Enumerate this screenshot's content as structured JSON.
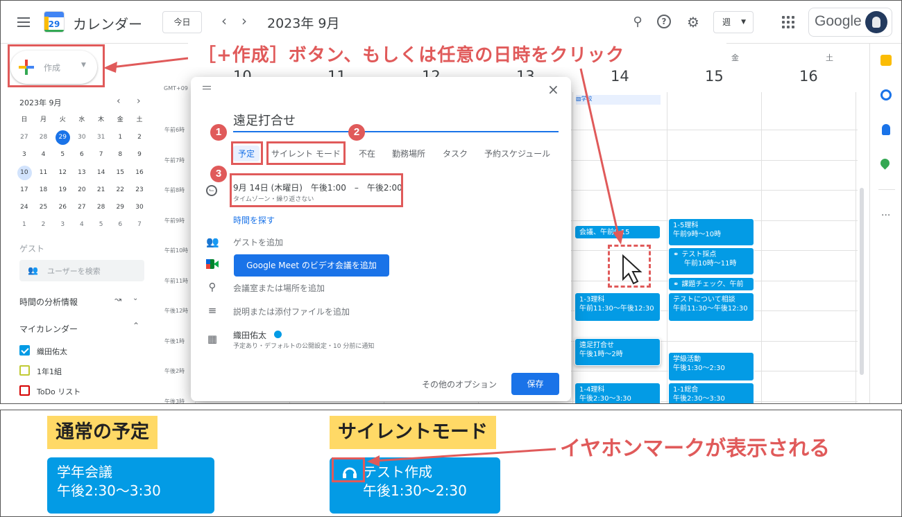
{
  "header": {
    "app_title": "カレンダー",
    "logo_day": "29",
    "today_label": "今日",
    "month_title": "2023年 9月",
    "view_label": "週",
    "google_label": "Google"
  },
  "sidebar": {
    "create_label": "作成",
    "mini_month": "2023年 9月",
    "weekdays": [
      "日",
      "月",
      "火",
      "水",
      "木",
      "金",
      "土"
    ],
    "weeks": [
      [
        "27",
        "28",
        "29",
        "30",
        "31",
        "1",
        "2"
      ],
      [
        "3",
        "4",
        "5",
        "6",
        "7",
        "8",
        "9"
      ],
      [
        "10",
        "11",
        "12",
        "13",
        "14",
        "15",
        "16"
      ],
      [
        "17",
        "18",
        "19",
        "20",
        "21",
        "22",
        "23"
      ],
      [
        "24",
        "25",
        "26",
        "27",
        "28",
        "29",
        "30"
      ],
      [
        "1",
        "2",
        "3",
        "4",
        "5",
        "6",
        "7"
      ]
    ],
    "guest_heading": "ゲスト",
    "guest_search_placeholder": "ユーザーを検索",
    "analytics_heading": "時間の分析情報",
    "my_calendars_heading": "マイカレンダー",
    "calendars": [
      {
        "name": "織田佑太",
        "color": "#039be5",
        "checked": true
      },
      {
        "name": "1年1組",
        "color": "#c0ca33",
        "checked": false
      },
      {
        "name": "ToDo リスト",
        "color": "#d50000",
        "checked": false
      }
    ]
  },
  "calendar": {
    "timezone": "GMT+09",
    "columns": [
      {
        "dow": "",
        "date": "10"
      },
      {
        "dow": "",
        "date": "11"
      },
      {
        "dow": "",
        "date": "12"
      },
      {
        "dow": "",
        "date": "13"
      },
      {
        "dow": "",
        "date": "14"
      },
      {
        "dow": "金",
        "date": "15"
      },
      {
        "dow": "土",
        "date": "16"
      }
    ],
    "time_labels": [
      "午前6時",
      "午前7時",
      "午前8時",
      "午前9時",
      "午前10時",
      "午前11時",
      "午後12時",
      "午後1時",
      "午後2時",
      "午後3時"
    ],
    "allday_event": "学校",
    "events": [
      {
        "title": "会議、午前9:15",
        "time": ""
      },
      {
        "title": "1-3理科",
        "time": "午前11:30～午後12:30"
      },
      {
        "title": "遠足打合せ",
        "time": "午後1時～2時"
      },
      {
        "title": "1-4理科",
        "time": "午後2:30～3:30"
      },
      {
        "title": "1-5理科",
        "time": "午前9時～10時"
      },
      {
        "title": "テスト採点",
        "time": "午前10時～11時",
        "silent": true
      },
      {
        "title": "課題チェック、午前",
        "time": "",
        "silent": true
      },
      {
        "title": "テストについて相談",
        "time": "午前11:30～午後12:30"
      },
      {
        "title": "学級活動",
        "time": "午後1:30～2:30"
      },
      {
        "title": "1-1総合",
        "time": "午後2:30～3:30"
      }
    ],
    "accent": "#039be5"
  },
  "dialog": {
    "title_value": "遠足打合せ",
    "tabs": [
      "予定",
      "サイレント モード",
      "不在",
      "勤務場所",
      "タスク",
      "予約スケジュール"
    ],
    "datetime": "9月 14日 (木曜日)　午後1:00　–　午後2:00",
    "datetime_sub": "タイムゾーン・繰り返さない",
    "find_time": "時間を探す",
    "add_guests": "ゲストを追加",
    "meet_button": "Google Meet のビデオ会議を追加",
    "add_location": "会議室または場所を追加",
    "add_description": "説明または添付ファイルを追加",
    "owner": "織田佑太",
    "owner_sub": "予定あり・デフォルトの公開設定・10 分前に通知",
    "more_options": "その他のオプション",
    "save": "保存"
  },
  "annotations": {
    "callout": "［+作成］ボタン、もしくは任意の日時をクリック",
    "badges": [
      "1",
      "2",
      "3"
    ],
    "color": "#e05a5a"
  },
  "legend": {
    "normal_tag": "通常の予定",
    "normal_title": "学年会議",
    "normal_time": "午後2:30～3:30",
    "silent_tag": "サイレントモード",
    "silent_title": "テスト作成",
    "silent_time": "午後1:30～2:30",
    "note": "イヤホンマークが表示される"
  }
}
